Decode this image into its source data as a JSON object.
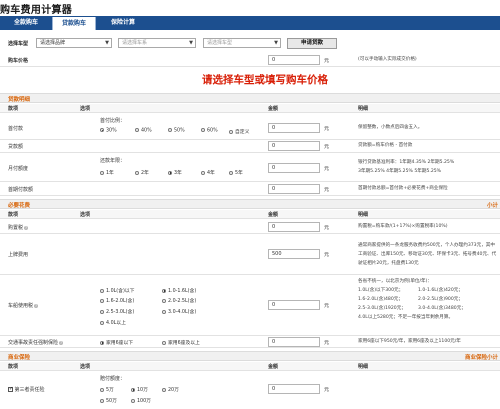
{
  "app": {
    "title": "购车费用计算器"
  },
  "tabs": [
    {
      "label": "全款购车"
    },
    {
      "label": "贷款购车"
    },
    {
      "label": "保险计算"
    }
  ],
  "selector": {
    "label": "选择车型",
    "brand": "请选择品牌",
    "series": "请选择车系",
    "model": "请选择车型",
    "query_button": "申请贷款"
  },
  "price_row": {
    "label": "购车价格",
    "value": "0",
    "unit": "元",
    "note": "(可以手动输入实际成交价格)"
  },
  "prompt": "请选择车型或填写购车价格",
  "loan_section": {
    "title": "贷款明细"
  },
  "col_headers": {
    "item": "款项",
    "option": "选项",
    "amount": "金额",
    "detail": "明细"
  },
  "down_payment": {
    "label": "首付款",
    "sub": "首付比例：",
    "options": [
      "30%",
      "40%",
      "50%",
      "60%",
      "自定义"
    ],
    "selected": "30%",
    "value": "0",
    "unit": "元",
    "note": "保留整数，小数点后四舍五入。"
  },
  "loan_amount": {
    "label": "贷款额",
    "value": "0",
    "unit": "元",
    "note": "贷款额=购车价格 - 首付款"
  },
  "monthly": {
    "label": "月付额度",
    "sub": "还款年限：",
    "options": [
      "1年",
      "2年",
      "3年",
      "4年",
      "5年"
    ],
    "selected": "3年",
    "value": "0",
    "unit": "元",
    "note1": "银行贷款基准利率：1年期4.35% 2年期5.25%",
    "note2": "3年期5.25% 4年期5.25% 5年期5.25%"
  },
  "first_pay": {
    "label": "首期付款额",
    "value": "0",
    "unit": "元",
    "note": "首期付款总额=首付款+必要花费+商业保险"
  },
  "required_section": {
    "title": "必要花费",
    "right": "小计"
  },
  "purchase_tax": {
    "label": "购置税",
    "value": "0",
    "unit": "元",
    "note": "购置税=购车款/(1+17%)×购置税率(10%)"
  },
  "plate_fee": {
    "label": "上牌费用",
    "value": "500",
    "unit": "元",
    "note1": "通常商家提供的一条龙服务收费约500元，个人办理约373元，其中",
    "note2": "工商验证、出库150元、移动证30元、环保卡3元、拓号费40元、代",
    "note3": "驶证相片20元，托盘费130元"
  },
  "vehicle_tax": {
    "label": "车船使用税",
    "options": [
      "1.0L(含)以下",
      "1.0-1.6L(含)",
      "1.6-2.0L(含)",
      "2.0-2.5L(含)",
      "2.5-3.0L(含)",
      "3.0-4.0L(含)",
      "4.0L以上"
    ],
    "selected": "1.0-1.6L(含)",
    "value": "0",
    "unit": "元",
    "note_title": "各省不统一，以北京为例(单位/年)：",
    "notes": [
      "1.0L(含)以下300元；",
      "1.0-1.6L(含)420元；",
      "1.6-2.0L(含)480元；",
      "2.0-2.5L(含)900元；",
      "2.5-3.0L(含)1920元；",
      "3.0-4.0L(含)3480元；",
      "4.0L以上5280元；不足一年按当年剩余月算。"
    ]
  },
  "compulsory": {
    "label": "交通事故责任强制保险",
    "options": [
      "家用6座以下",
      "家用6座及以上"
    ],
    "selected": "家用6座以下",
    "value": "0",
    "unit": "元",
    "note": "家用6座以下950元/年，家用6座及以上1100元/年"
  },
  "commercial_section": {
    "title": "商业保险",
    "right": "商业保险小计"
  },
  "third_party": {
    "label": "第三者责任险",
    "checked": true,
    "sub": "赔付额度：",
    "options": [
      "5万",
      "10万",
      "20万",
      "50万",
      "100万"
    ],
    "selected": "10万",
    "value": "0",
    "unit": "元"
  }
}
